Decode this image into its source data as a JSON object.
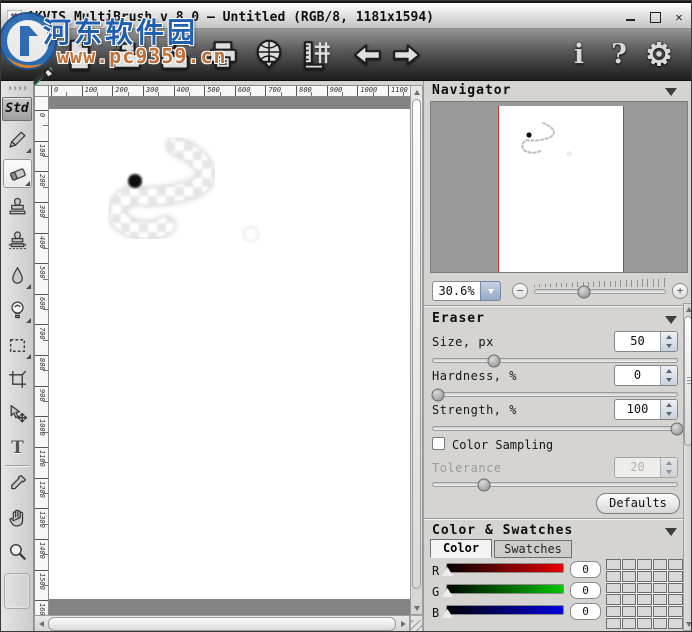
{
  "window": {
    "title": "AKVIS MultiBrush v.8.0 — Untitled (RGB/8, 1181x1594)",
    "controls": [
      "minimize",
      "maximize",
      "close"
    ],
    "close_glyph": "✕"
  },
  "watermark": {
    "site_name": "河东软件园",
    "site_url": "www.pc9359.cn"
  },
  "toolbar": {
    "icons": [
      "new-document",
      "open",
      "save",
      "print",
      "import",
      "canvas-size",
      "undo",
      "redo",
      "info",
      "help",
      "preferences"
    ],
    "info_glyph": "i",
    "help_glyph": "?",
    "gear_glyph": "⚙"
  },
  "tools": {
    "expand_glyph": "››››",
    "mode_label": "Std",
    "items": [
      "pencil",
      "eraser",
      "clone-stamp",
      "chameleon-brush",
      "blur",
      "history-brush",
      "selection",
      "crop",
      "transform",
      "text",
      "eyedropper",
      "hand",
      "zoom"
    ],
    "selected": "eraser",
    "text_tool_glyph": "T"
  },
  "rulers": {
    "horizontal": [
      "0",
      "100",
      "200",
      "300",
      "400",
      "500",
      "600",
      "700",
      "800",
      "900",
      "1000",
      "1100"
    ],
    "vertical": [
      "0",
      "100",
      "200",
      "300",
      "400",
      "500",
      "600",
      "700",
      "800",
      "900",
      "1000",
      "1100",
      "1200",
      "1300",
      "1400",
      "1500",
      "1600"
    ]
  },
  "navigator": {
    "title": "Navigator",
    "zoom_value": "30.6%",
    "zoom_slider_percent": 38,
    "minus_glyph": "−",
    "plus_glyph": "+"
  },
  "eraser": {
    "title": "Eraser",
    "params": [
      {
        "label": "Size, px",
        "value": "50",
        "percent": 25
      },
      {
        "label": "Hardness, %",
        "value": "0",
        "percent": 2
      },
      {
        "label": "Strength, %",
        "value": "100",
        "percent": 100
      }
    ],
    "color_sampling_label": "Color Sampling",
    "color_sampling_checked": false,
    "tolerance": {
      "label": "Tolerance",
      "value": "20",
      "percent": 21,
      "enabled": false
    },
    "defaults_label": "Defaults"
  },
  "color_swatches": {
    "title": "Color & Swatches",
    "tabs": [
      "Color",
      "Swatches"
    ],
    "active_tab": "Color",
    "channels": [
      {
        "label": "R",
        "value": "0"
      },
      {
        "label": "G",
        "value": "0"
      },
      {
        "label": "B",
        "value": "0"
      }
    ],
    "grid": {
      "rows": 6,
      "cols": 5
    }
  },
  "colors": {
    "watermark_blue": "#1f5fae",
    "watermark_orange": "#bf7038",
    "navigator_page_border": "#c23a32",
    "canvas_workspace": "#838383",
    "panel_background": "#d6d4d0"
  }
}
